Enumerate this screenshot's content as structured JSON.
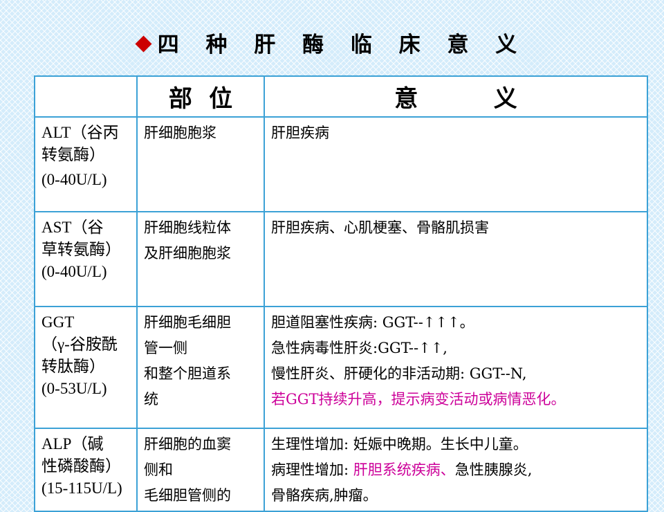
{
  "title": "四 种 肝 酶 临 床 意 义",
  "colors": {
    "diamond": "#cc0000",
    "border": "#3ba1d6",
    "highlight": "#cc0099"
  },
  "table": {
    "headers": {
      "blank": "",
      "site": [
        "部",
        "位"
      ],
      "meaning": [
        "意",
        "义"
      ]
    },
    "rows": [
      {
        "name": [
          "ALT（谷丙",
          "转氨酶）",
          "(0-40U/L)"
        ],
        "site": [
          "肝细胞胞浆"
        ],
        "meaning": [
          {
            "text": "肝胆疾病"
          }
        ]
      },
      {
        "name": [
          "AST（谷",
          "草转氨酶）",
          "(0-40U/L)"
        ],
        "site": [
          "肝细胞线粒体",
          "及肝细胞胞浆"
        ],
        "meaning": [
          {
            "text": "肝胆疾病、心肌梗塞、骨骼肌损害"
          }
        ]
      },
      {
        "name": [
          "GGT",
          "（γ-谷胺酰",
          "转肽酶）",
          "(0-53U/L)"
        ],
        "site": [
          "肝细胞毛细胆",
          "管一侧",
          "和整个胆道系",
          "统"
        ],
        "meaning": [
          {
            "text": "胆道阻塞性疾病: GGT--↑↑↑。"
          },
          {
            "text": "急性病毒性肝炎:GGT--↑↑,"
          },
          {
            "text": "慢性肝炎、肝硬化的非活动期: GGT--N,"
          },
          {
            "text": "若GGT持续升高，提示病变活动或病情恶化。"
          }
        ]
      },
      {
        "name": [
          "ALP（碱",
          "性磷酸酶）",
          "(15-115U/L)"
        ],
        "site": [
          "肝细胞的血窦",
          "侧和",
          "毛细胆管侧的"
        ],
        "meaning": [
          {
            "text": "生理性增加: 妊娠中晚期。生长中儿童。"
          },
          {
            "text_a": "病理性增加: ",
            "text_b": "肝胆系统疾病、",
            "text_c": "急性胰腺炎,"
          },
          {
            "text": "骨骼疾病,肿瘤。"
          }
        ]
      }
    ]
  }
}
